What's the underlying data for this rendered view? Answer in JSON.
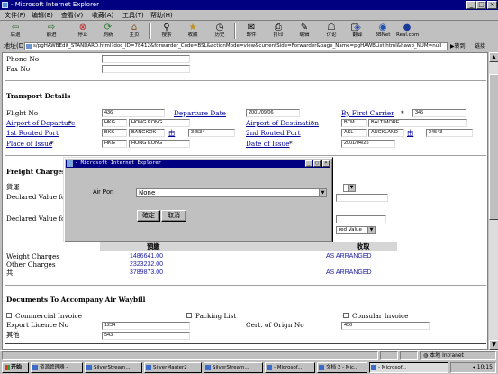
{
  "window": {
    "title": "- Microsoft Internet Explorer"
  },
  "menu": [
    "文件(F)",
    "编辑(E)",
    "查看(V)",
    "收藏(A)",
    "工具(T)",
    "帮助(H)"
  ],
  "toolbar": [
    {
      "label": "后退",
      "icon": "back-arrow-icon"
    },
    {
      "label": "前进",
      "icon": "forward-arrow-icon"
    },
    {
      "label": "停止",
      "icon": "stop-icon"
    },
    {
      "label": "刷新",
      "icon": "refresh-icon"
    },
    {
      "label": "主页",
      "icon": "home-icon"
    },
    {
      "label": "搜索",
      "icon": "search-icon"
    },
    {
      "label": "收藏",
      "icon": "favorites-icon"
    },
    {
      "label": "历史",
      "icon": "history-icon"
    },
    {
      "label": "邮件",
      "icon": "mail-icon"
    },
    {
      "label": "打印",
      "icon": "print-icon"
    },
    {
      "label": "编辑",
      "icon": "edit-icon"
    },
    {
      "label": "讨论",
      "icon": "discuss-icon"
    },
    {
      "label": "",
      "icon": "blank-icon"
    },
    {
      "label": "翻译",
      "icon": "translate-icon"
    },
    {
      "label": "3BNet",
      "icon": "3bnet-icon"
    },
    {
      "label": "Real.com",
      "icon": "real-icon"
    }
  ],
  "address": {
    "label": "地址(D)",
    "url": "s/pgHAWBEdit_STANDARD.html?doc_ID=78412&forwarder_Code=BSL&actionMode=view&currentSide=Forwarder&page_Name=pgHAWBList.html&hawb_NUM=null",
    "go": "转到",
    "links": "链接"
  },
  "form": {
    "phone_label": "Phone No",
    "fax_label": "Fax No",
    "transport_title": "Transport Details",
    "flight_label": "Flight No",
    "flight_value": "436",
    "departure_date_label": "Departure Date",
    "departure_date_value": "2001/09/06",
    "first_carrier_label": "By First Carrier",
    "first_carrier_value": "345",
    "airport_departure_label": "Airport of Departure",
    "airport_departure_code": "HKG",
    "airport_departure_name": "HONG KONG",
    "airport_destination_label": "Airport of Destination",
    "airport_destination_code": "BTM",
    "airport_destination_name": "BALTIMORE",
    "first_routed_label": "1st Routed Port",
    "first_routed_code": "BKK",
    "first_routed_name": "BANGKOK",
    "first_routed_by": "由",
    "first_routed_num": "34534",
    "second_routed_label": "2nd Routed Port",
    "second_routed_code": "AKL",
    "second_routed_name": "AUCKLAND",
    "second_routed_by": "由",
    "second_routed_num": "34543",
    "place_issue_label": "Place of Issue",
    "place_issue_code": "HKG",
    "place_issue_name": "HONG KONG",
    "date_issue_label": "Date of Issue",
    "date_issue_value": "2001/04/25",
    "freight_title": "Freight Charges",
    "currency_label": "貨運",
    "declared_value_label1": "Declared Value for",
    "declared_value_label2": "Declared Value for",
    "declared_select": "red Value",
    "col_prepaid": "預繳",
    "col_collect": "收取",
    "weight_label": "Weight Charges",
    "weight_prepaid": "1486641.00",
    "weight_collect": "AS ARRANGED",
    "other_label": "Other Charges",
    "other_prepaid": "2323232.00",
    "total_label": "共",
    "total_prepaid": "3789873.00",
    "total_collect": "AS ARRANGED",
    "docs_title": "Documents To Accompany Air Waybill",
    "commercial_invoice": "Commercial Invoice",
    "packing_list": "Packing List",
    "consular_invoice": "Consular Invoice",
    "export_licence_label": "Export Licence No",
    "export_licence_value": "1234",
    "cert_origin_label": "Cert. of Orign No",
    "cert_origin_value": "456",
    "other_doc_label": "其他",
    "other_doc_value": "543"
  },
  "dialog": {
    "title": "- Microsoft Internet Explorer",
    "airport_label": "Air Port",
    "airport_value": "None",
    "ok": "確定",
    "cancel": "取消"
  },
  "status": {
    "zone": "本地 Intranet"
  },
  "taskbar": {
    "start": "开始",
    "tasks": [
      "资源管理器 -",
      "SilverStream...",
      "SilverMaster2",
      "SilverStream...",
      "- Microsof...",
      "文档 3 - Mic...",
      "- Microsof..."
    ],
    "clock": "10:15"
  }
}
